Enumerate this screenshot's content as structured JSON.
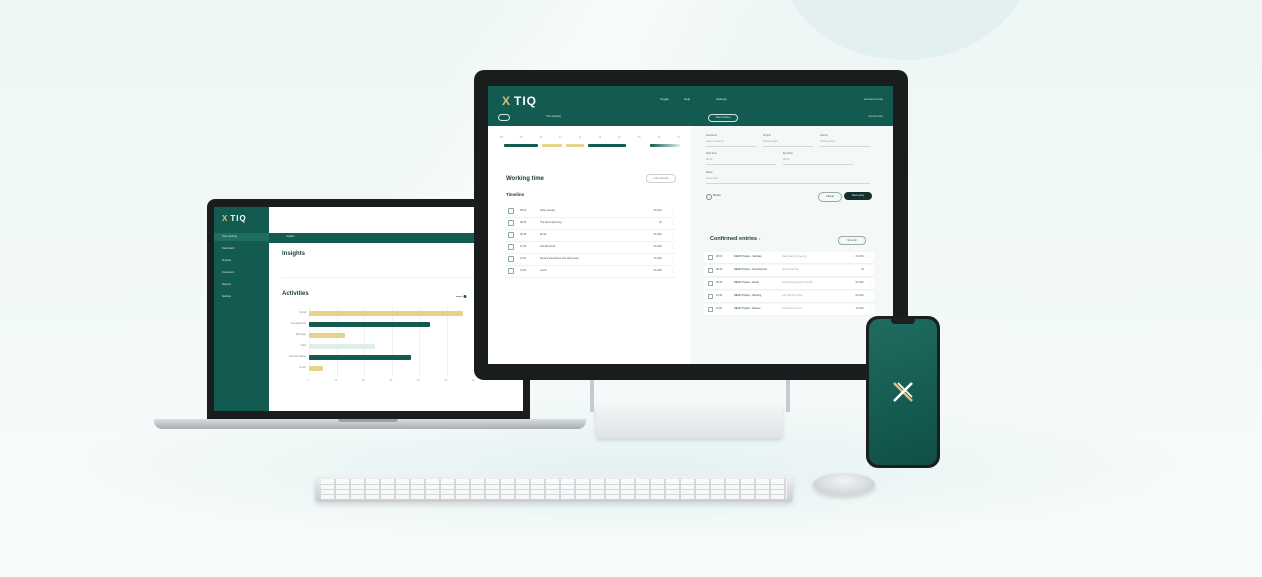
{
  "brand": {
    "logo_mark": "X",
    "name": "TIQ"
  },
  "monitor": {
    "header_nav": [
      "Toggle",
      "Help",
      "Settings"
    ],
    "user_label": "Account name",
    "pill_label": "Start tracking",
    "breadcrumb": "Time tracking",
    "breadcrumb_right": "Current entry",
    "timeline_hours": [
      "08",
      "09",
      "10",
      "11",
      "12",
      "13",
      "14",
      "15",
      "16",
      "17"
    ],
    "working_time_title": "Working time",
    "working_time_button": "Add manually",
    "timeline_title": "Timeline",
    "timeline_rows": [
      {
        "time": "08:00",
        "label": "Daily standup",
        "duration": "0h 15m"
      },
      {
        "time": "08:30",
        "label": "TIQ Sprint planning",
        "duration": "1h"
      },
      {
        "time": "09:45",
        "label": "Email",
        "duration": "0h 45m"
      },
      {
        "time": "10:30",
        "label": "Call Microsoft",
        "duration": "0h 30m"
      },
      {
        "time": "11:00",
        "label": "Review timesheets with client team",
        "duration": "1h 30m"
      },
      {
        "time": "13:00",
        "label": "Lunch",
        "duration": "0h 45m"
      }
    ],
    "form_labels": [
      "Customer",
      "Project",
      "Activity",
      "Start time",
      "End time",
      "Notes"
    ],
    "form_placeholders": [
      "Select customer",
      "Select project",
      "Select activity",
      "00:00",
      "00:00",
      "Add a note"
    ],
    "radio_label": "Billable",
    "cancel_label": "Cancel",
    "save_label": "Save entry",
    "confirmed_title": "Confirmed entries",
    "confirmed_count": "5",
    "confirmed_button": "Show all",
    "confirmed_rows": [
      {
        "time": "08:00",
        "label": "DEMO Project - Standup",
        "desc": "Daily standup meeting",
        "duration": "0h 15m"
      },
      {
        "time": "08:30",
        "label": "DEMO Project - Development",
        "desc": "Sprint planning",
        "duration": "1h"
      },
      {
        "time": "09:45",
        "label": "DEMO Project - Email",
        "desc": "Answering customer emails",
        "duration": "0h 45m"
      },
      {
        "time": "10:30",
        "label": "DEMO Project - Meeting",
        "desc": "Call with Microsoft",
        "duration": "0h 30m"
      },
      {
        "time": "11:00",
        "label": "DEMO Project - Review",
        "desc": "Timesheet review",
        "duration": "1h 30m"
      }
    ]
  },
  "laptop": {
    "nav": [
      "Time tracking",
      "Dashboard",
      "Projects",
      "Customers",
      "Reports",
      "Settings"
    ],
    "tab": "Insights",
    "insights_title": "Insights",
    "activities_title": "Activities",
    "activities": [
      {
        "label": "Email",
        "value": 56,
        "color": "#e6d38a"
      },
      {
        "label": "Development",
        "value": 44,
        "color": "#135a50"
      },
      {
        "label": "Meetings",
        "value": 13,
        "color": "#e6d38a"
      },
      {
        "label": "Calls",
        "value": 24,
        "color": "#dfeeec"
      },
      {
        "label": "Documentation",
        "value": 37,
        "color": "#135a50"
      },
      {
        "label": "Lunch",
        "value": 5,
        "color": "#e6d38a"
      }
    ],
    "x_ticks": [
      "0",
      "10",
      "20",
      "30",
      "40",
      "50",
      "60"
    ]
  },
  "colors": {
    "brand_green": "#135a50",
    "accent_gold": "#d7c27a"
  }
}
